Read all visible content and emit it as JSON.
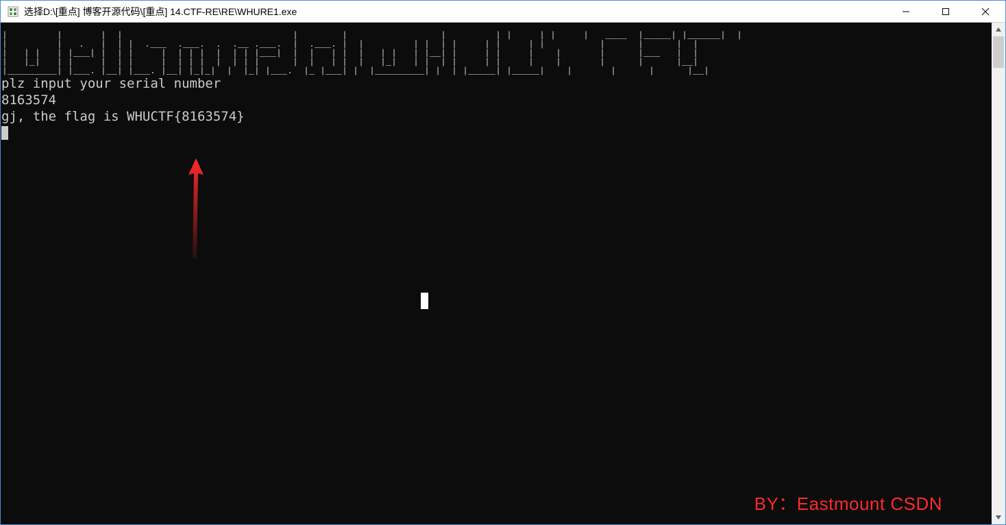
{
  "window": {
    "title": "选择D:\\[重点] 博客开源代码\\[重点] 14.CTF-RE\\RE\\WHURE1.exe"
  },
  "console": {
    "ascii_art": "|         |       |  |                               |        |                 |         | |     | |     |   ____  |_____| |______|  |\n|         |   .   |  | |  .___  .___.  .  .__ .___.  |  .___. |  |         | |  | |     | |     | |          |      |      |  |\n|   | |   | |___| |  | |     |  | | |  |  | | |___|  |  |   | |  |   | |   | |__| |     | |     |    |       |      |___   |  |\n|   |_|   | |     |  | |     |  | | |  |  | | |      |  |   | |  |   |_|   | |  | |     | |     |    |       |      |      |__|\n|_________| |___. |__| |___. |__| |_|_|  |  |_| |___.  |_ |___| |  |_________| |  | |_____| |_____|    |       |      |      |__|",
    "prompt_line": "plz input your serial number",
    "input_line": "8163574",
    "result_line": "gj, the flag is WHUCTF{8163574}"
  },
  "watermark": {
    "text": "BY：Eastmount CSDN"
  },
  "colors": {
    "console_bg": "#0c0c0c",
    "console_fg": "#cccccc",
    "arrow": "#ff2a2a",
    "watermark": "#ff2a2a",
    "titlebar_bg": "#ffffff",
    "border": "#4a8cd8"
  }
}
